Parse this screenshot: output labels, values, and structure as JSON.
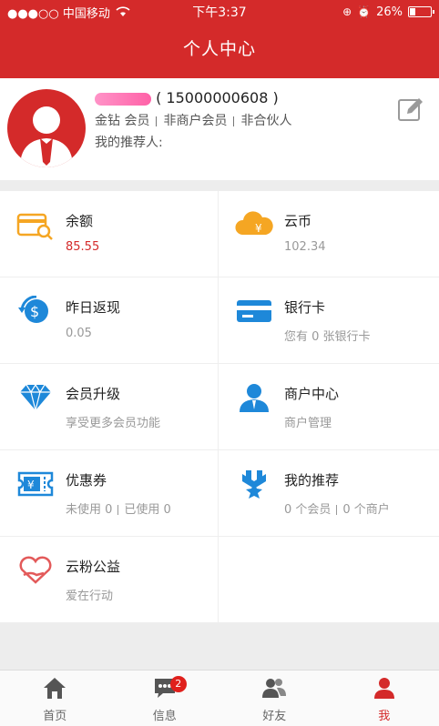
{
  "status_bar": {
    "carrier": "●●●○○ 中国移动",
    "time": "下午3:37",
    "battery": "26%",
    "battery_level": 0.26
  },
  "header": {
    "title": "个人中心"
  },
  "profile": {
    "phone": "( 15000000608 )",
    "tag1": "金钻 会员",
    "tag2": "非商户会员",
    "tag3": "非合伙人",
    "referrer": "我的推荐人:"
  },
  "grid": [
    {
      "title": "余额",
      "sub": "85.55"
    },
    {
      "title": "云币",
      "sub": "102.34"
    },
    {
      "title": "昨日返现",
      "sub": "0.05"
    },
    {
      "title": "银行卡",
      "sub": "您有 0 张银行卡"
    },
    {
      "title": "会员升级",
      "sub": "享受更多会员功能"
    },
    {
      "title": "商户中心",
      "sub": "商户管理"
    },
    {
      "title": "优惠券",
      "sub_a": "未使用 0",
      "sub_b": "已使用 0"
    },
    {
      "title": "我的推荐",
      "sub_a": "0 个会员",
      "sub_b": "0 个商户"
    },
    {
      "title": "云粉公益",
      "sub": "爱在行动"
    }
  ],
  "tabs": [
    {
      "label": "首页",
      "icon": "home-icon"
    },
    {
      "label": "信息",
      "icon": "message-icon",
      "badge": "2"
    },
    {
      "label": "好友",
      "icon": "friends-icon"
    },
    {
      "label": "我",
      "icon": "me-icon"
    }
  ],
  "colors": {
    "brand": "#d42a2a",
    "icon_orange": "#f5a623",
    "icon_blue": "#1e88d9"
  }
}
